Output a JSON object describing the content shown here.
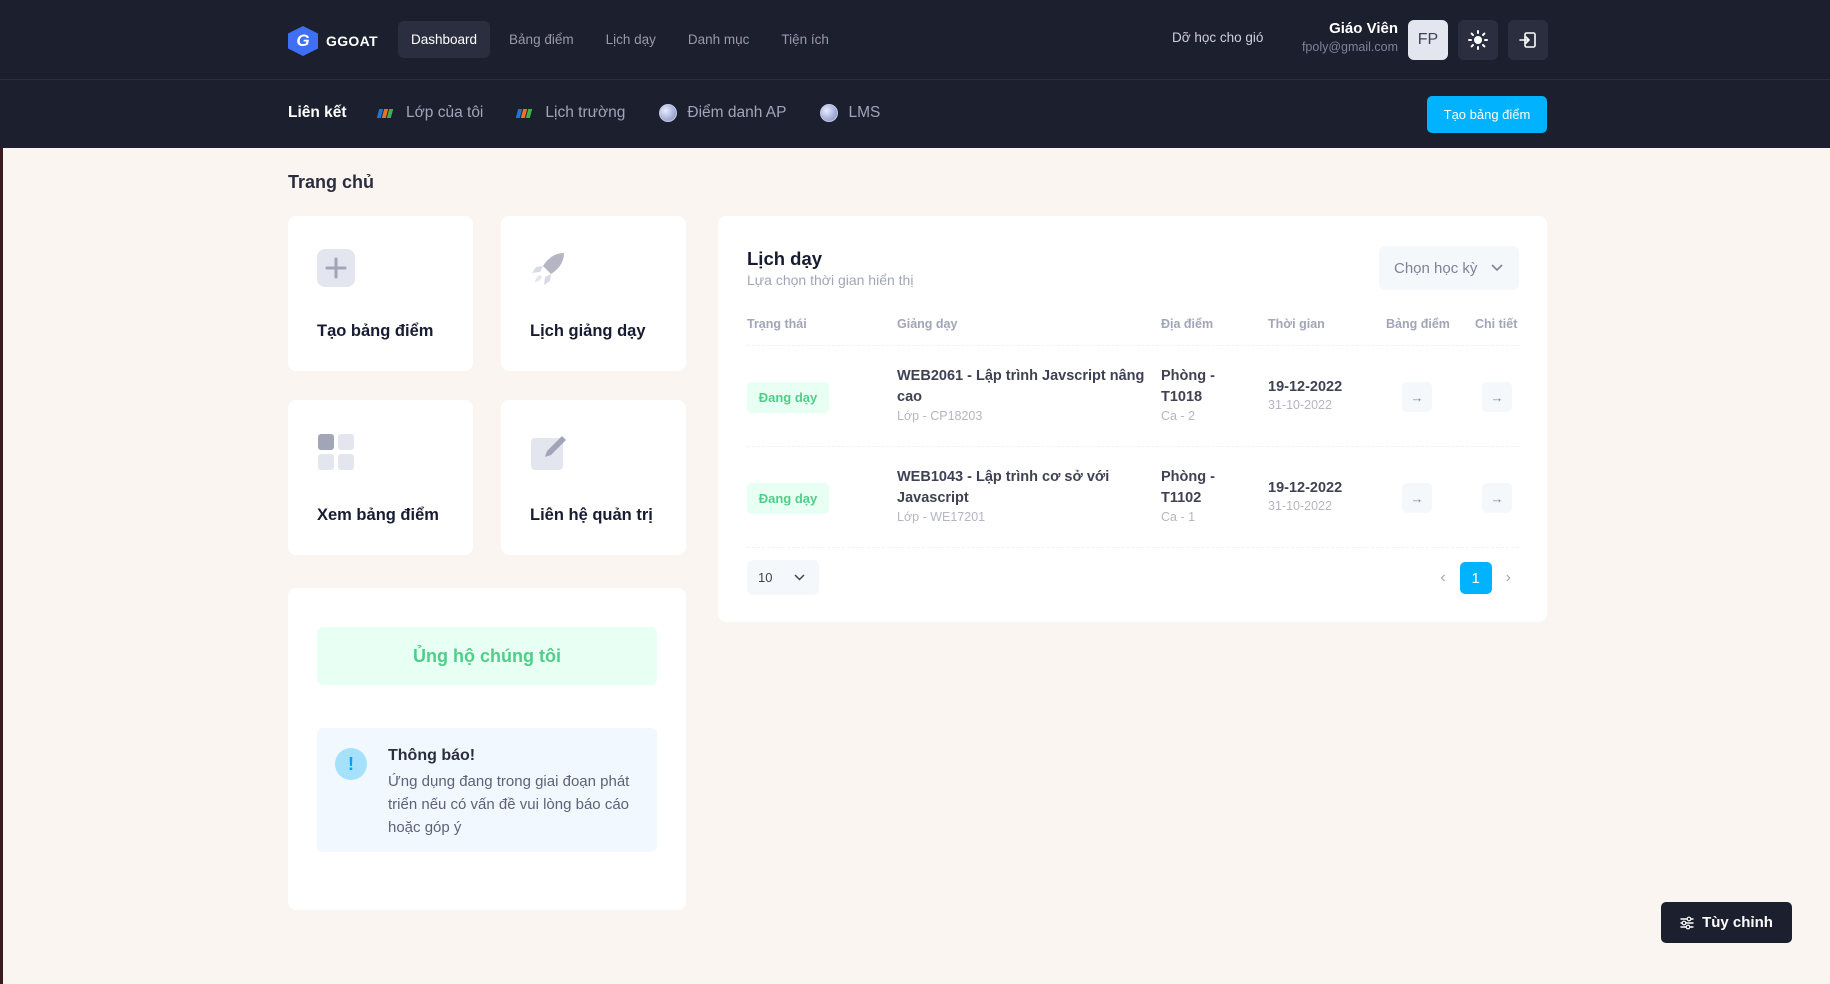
{
  "header": {
    "logo_text": "GGOAT",
    "logo_letter": "G",
    "nav": [
      {
        "label": "Dashboard",
        "active": true
      },
      {
        "label": "Bảng điểm",
        "active": false
      },
      {
        "label": "Lịch dạy",
        "active": false
      },
      {
        "label": "Danh mục",
        "active": false
      },
      {
        "label": "Tiện ích",
        "active": false
      }
    ],
    "tagline": "Dỡ học cho gió",
    "user_name": "Giáo Viên",
    "user_email": "fpoly@gmail.com",
    "avatar_initials": "FP",
    "theme_icon": "sun-icon",
    "logout_icon": "logout-icon"
  },
  "subbar": {
    "title": "Liên kết",
    "links": [
      {
        "label": "Lớp của tôi",
        "icon": "fpt-logo-icon"
      },
      {
        "label": "Lịch trường",
        "icon": "fpt-logo-icon"
      },
      {
        "label": "Điểm danh AP",
        "icon": "globe-icon"
      },
      {
        "label": "LMS",
        "icon": "globe-icon"
      }
    ],
    "cta_label": "Tạo bảng điểm"
  },
  "page": {
    "title": "Trang chủ"
  },
  "tiles": [
    {
      "label": "Tạo bảng điểm",
      "icon": "plus-icon"
    },
    {
      "label": "Lịch giảng dạy",
      "icon": "rocket-icon"
    },
    {
      "label": "Xem bảng điểm",
      "icon": "grid-icon"
    },
    {
      "label": "Liên hệ quản trị",
      "icon": "edit-icon"
    }
  ],
  "support": {
    "button_label": "Ủng hộ chúng tôi",
    "notice_icon": "!",
    "notice_title": "Thông báo!",
    "notice_text": "Ứng dụng đang trong giai đoạn phát triển nếu có vấn đề vui lòng báo cáo hoặc góp ý"
  },
  "schedule": {
    "title": "Lịch dạy",
    "subtitle": "Lựa chọn thời gian hiển thị",
    "semester_placeholder": "Chọn học kỳ",
    "columns": [
      "Trạng thái",
      "Giảng dạy",
      "Địa điểm",
      "Thời gian",
      "Bảng điểm",
      "Chi tiết"
    ],
    "rows": [
      {
        "status": "Đang dạy",
        "course": "WEB2061 - Lập trình Javscript nâng cao",
        "class": "Lớp - CP18203",
        "room": "Phòng - T1018",
        "shift": "Ca - 2",
        "date_end": "19-12-2022",
        "date_start": "31-10-2022"
      },
      {
        "status": "Đang dạy",
        "course": "WEB1043 - Lập trình cơ sở với Javascript",
        "class": "Lớp - WE17201",
        "room": "Phòng - T1102",
        "shift": "Ca - 1",
        "date_end": "19-12-2022",
        "date_start": "31-10-2022"
      }
    ],
    "page_size": "10",
    "current_page": "1",
    "prev": "‹",
    "next": "›"
  },
  "customize": {
    "label": "Tùy chỉnh"
  }
}
